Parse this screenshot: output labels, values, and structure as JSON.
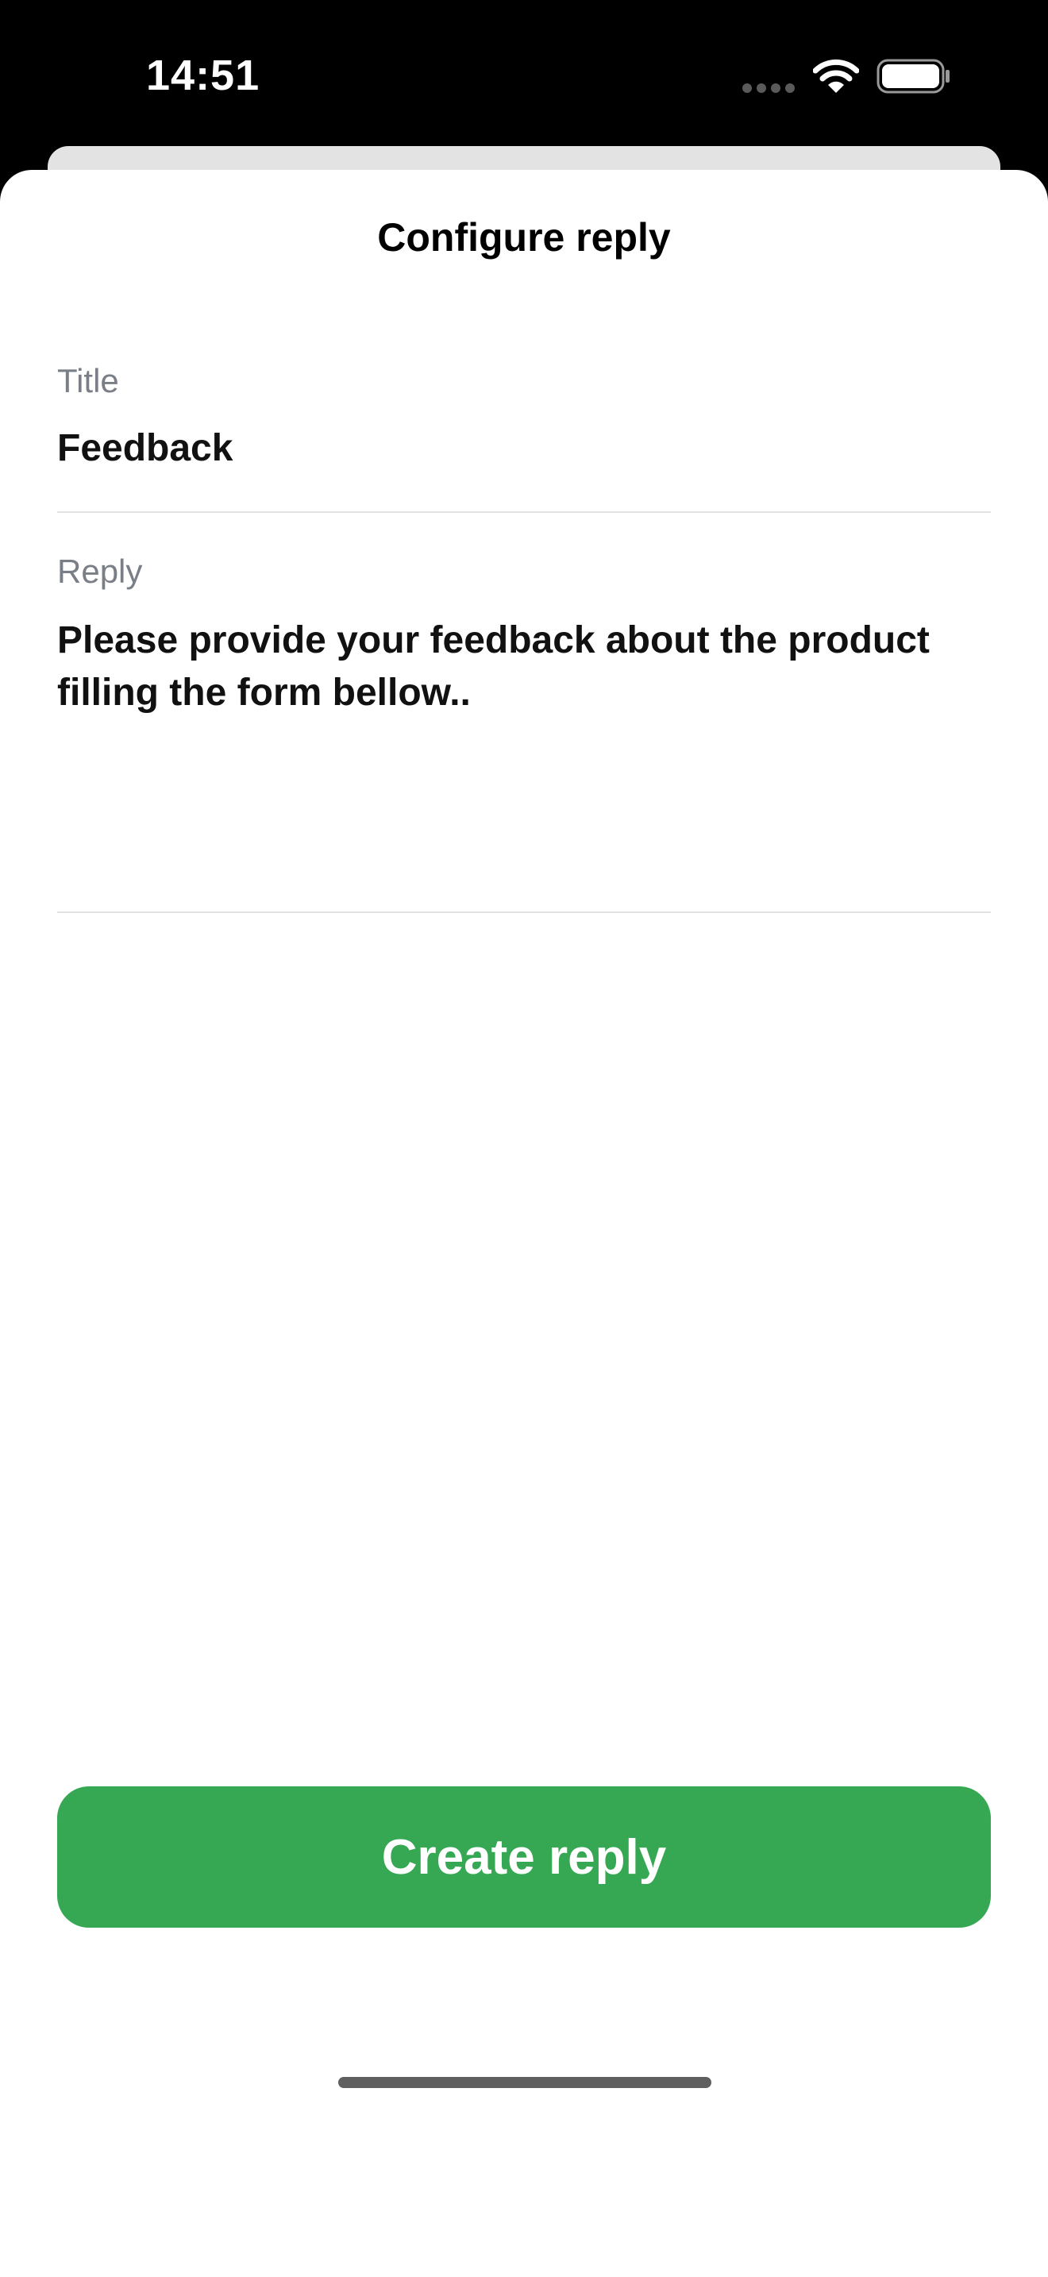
{
  "status_bar": {
    "time": "14:51",
    "icons": [
      "signal-dots-icon",
      "wifi-icon",
      "battery-icon"
    ]
  },
  "sheet": {
    "title": "Configure reply"
  },
  "form": {
    "title_label": "Title",
    "title_value": "Feedback",
    "reply_label": "Reply",
    "reply_value": "Please provide your feedback about the product filling the form bellow.."
  },
  "actions": {
    "create_label": "Create reply"
  },
  "colors": {
    "accent": "#36a853",
    "label": "#7a7f87",
    "divider": "#e2e2e2"
  }
}
